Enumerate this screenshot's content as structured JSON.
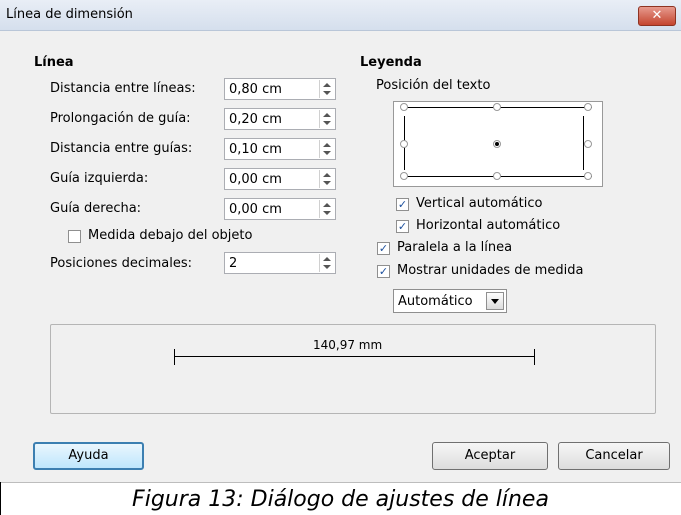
{
  "window": {
    "title": "Línea de dimensión",
    "close_glyph": "✕"
  },
  "line_section": {
    "heading": "Línea",
    "fields": [
      {
        "label": "Distancia entre líneas:",
        "value": "0,80 cm"
      },
      {
        "label": "Prolongación de guía:",
        "value": "0,20 cm"
      },
      {
        "label": "Distancia entre guías:",
        "value": "0,10 cm"
      },
      {
        "label": "Guía izquierda:",
        "value": "0,00 cm"
      },
      {
        "label": "Guía derecha:",
        "value": "0,00 cm"
      }
    ],
    "below_object": {
      "label": "Medida debajo del objeto",
      "checked": false
    },
    "decimals": {
      "label": "Posiciones decimales:",
      "value": "2"
    }
  },
  "legend_section": {
    "heading": "Leyenda",
    "text_position_label": "Posición del texto",
    "selected_position": "center",
    "checkboxes": [
      {
        "label": "Vertical automático",
        "checked": true
      },
      {
        "label": "Horizontal automático",
        "checked": true
      },
      {
        "label": "Paralela a la línea",
        "checked": true
      },
      {
        "label": "Mostrar unidades de medida",
        "checked": true
      }
    ],
    "unit_select": "Automático"
  },
  "preview": {
    "measure_text": "140,97 mm"
  },
  "buttons": {
    "help": "Ayuda",
    "ok": "Aceptar",
    "cancel": "Cancelar"
  },
  "caption": "Figura 13: Diálogo de ajustes de línea",
  "colors": {
    "accent": "#3c7fb1",
    "close": "#c4452f"
  },
  "icons": {
    "check": "checkmark-icon",
    "spin_up": "arrow-up-icon",
    "spin_down": "arrow-down-icon",
    "dropdown": "chevron-down-icon"
  }
}
